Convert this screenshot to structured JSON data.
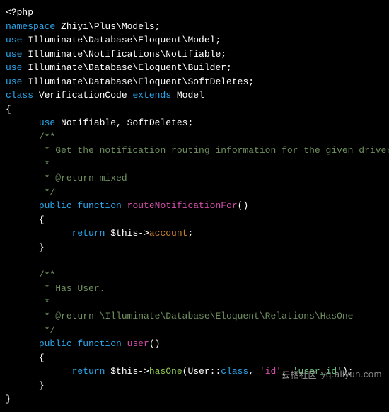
{
  "code": {
    "l1_open": "<?php",
    "l2_ns_kw": "namespace",
    "l2_ns_val": " Zhiyi\\Plus\\Models;",
    "l3_use_kw": "use",
    "l3_use_val": " Illuminate\\Database\\Eloquent\\Model;",
    "l4_use_kw": "use",
    "l4_use_val": " Illuminate\\Notifications\\Notifiable;",
    "l5_use_kw": "use",
    "l5_use_val": " Illuminate\\Database\\Eloquent\\Builder;",
    "l6_use_kw": "use",
    "l6_use_val": " Illuminate\\Database\\Eloquent\\SoftDeletes;",
    "l7_class_kw": "class",
    "l7_class_name": " VerificationCode ",
    "l7_extends_kw": "extends",
    "l7_extends_val": " Model",
    "l8_brace": "{",
    "l9_use_kw": "use",
    "l9_use_val": " Notifiable, SoftDeletes;",
    "c1_open": "/**",
    "c1_1": " * Get the notification routing information for the given driver.",
    "c1_2": " *",
    "c1_3": " * @return mixed",
    "c1_close": " */",
    "f1_vis": "public",
    "f1_fn": " function ",
    "f1_name": "routeNotificationFor",
    "f1_paren": "()",
    "f1_open": "{",
    "f1_ret_kw": "return ",
    "f1_this": "$this->",
    "f1_prop": "account",
    "f1_semi": ";",
    "f1_close": "}",
    "c2_open": "/**",
    "c2_1": " * Has User.",
    "c2_2": " *",
    "c2_3": " * @return \\Illuminate\\Database\\Eloquent\\Relations\\HasOne",
    "c2_close": " */",
    "f2_vis": "public",
    "f2_fn": " function ",
    "f2_name": "user",
    "f2_paren": "()",
    "f2_open": "{",
    "f2_ret_kw": "return ",
    "f2_this": "$this->",
    "f2_meth": "hasOne",
    "f2_arg_open": "(User::",
    "f2_class": "class",
    "f2_comma1": ", ",
    "f2_str1": "'id'",
    "f2_comma2": ", ",
    "f2_str2": "'user_id'",
    "f2_arg_close": ");",
    "f2_close": "}",
    "last_brace": "}"
  },
  "watermark": {
    "cn": "云栖社区",
    "url": "yq.aliyun.com"
  }
}
